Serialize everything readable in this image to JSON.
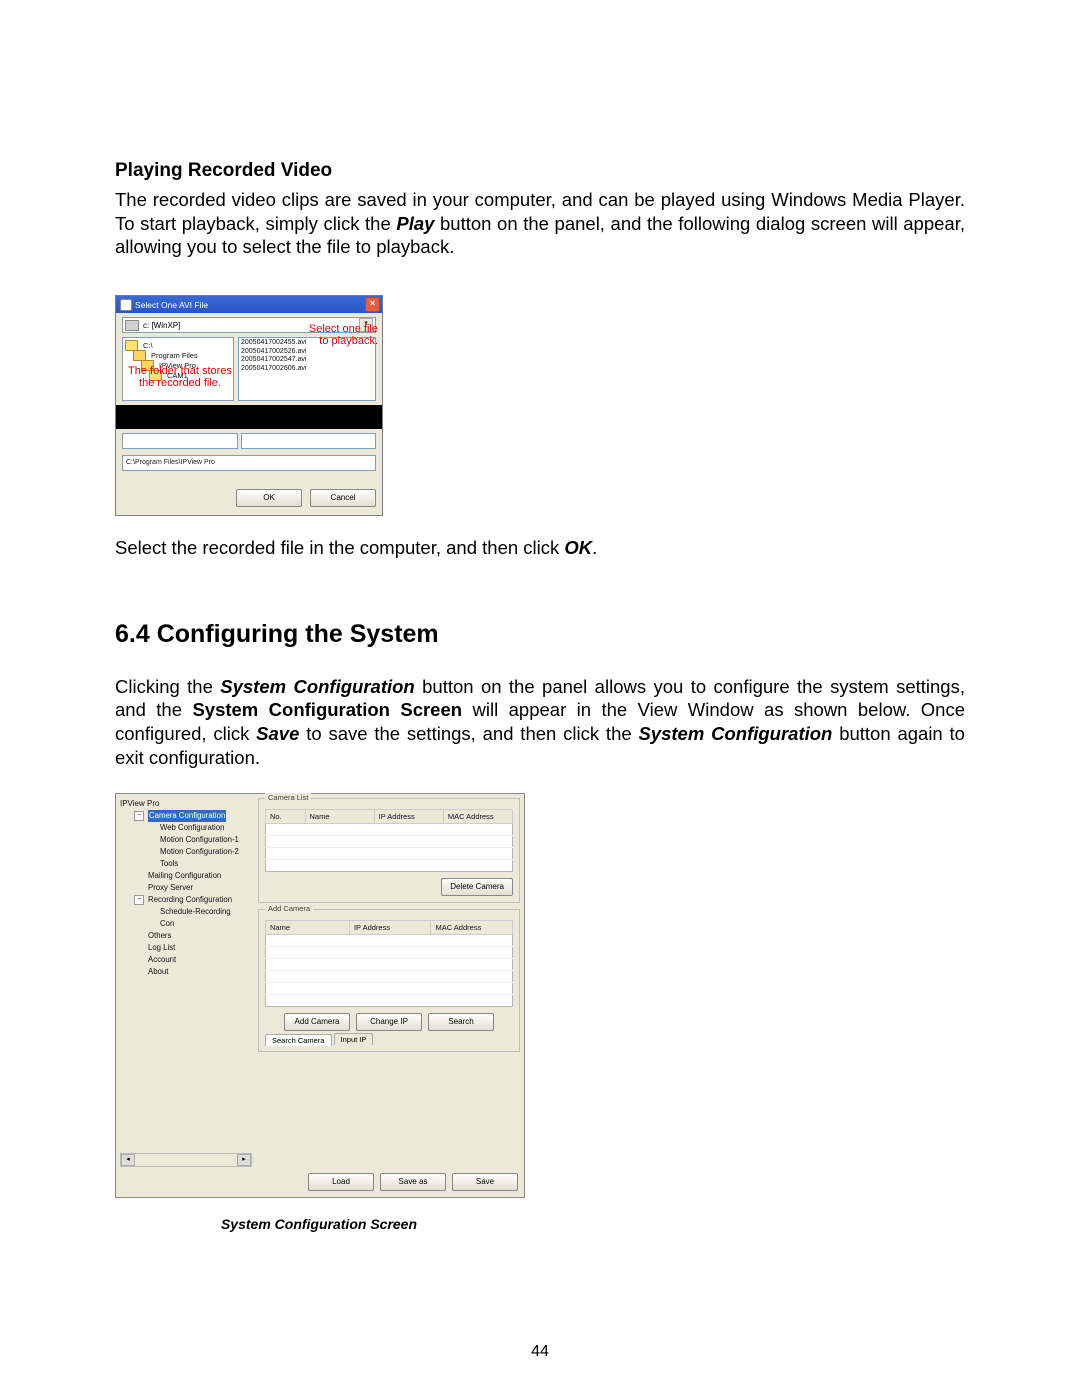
{
  "headings": {
    "h1": "Playing Recorded Video",
    "section64": "6.4 Configuring the System"
  },
  "paragraphs": {
    "p1_a": "The recorded video clips are saved in your computer, and can be played using Windows Media Player. To start playback, simply click the ",
    "p1_play": "Play",
    "p1_b": " button on the panel, and the following dialog screen will appear, allowing you to select the file to playback.",
    "p2_a": "Select the recorded file in the computer, and then click ",
    "p2_ok": "OK",
    "p2_b": ".",
    "p3_a": "Clicking the ",
    "p3_sysconf": "System Configuration",
    "p3_b": " button on the panel allows you to configure the system settings, and the ",
    "p3_scs": "System Configuration Screen",
    "p3_c": " will appear in the View Window as shown below. Once configured, click ",
    "p3_save": "Save",
    "p3_d": " to save the settings, and then click the ",
    "p3_sysconf2": "System Configuration",
    "p3_e": " button again to exit configuration."
  },
  "dialog1": {
    "title": "Select One AVI File",
    "drive_label": "c: [WinXP]",
    "tree": {
      "c": "C:\\",
      "progfiles": "Program Files",
      "ipview": "IPView Pro",
      "cam1": "CAM1"
    },
    "avi_files": [
      "20050417002455.avi",
      "20050417002526.avi",
      "20050417002547.avi",
      "20050417002606.avi"
    ],
    "path_value": "C:\\Program Files\\IPView Pro",
    "ok": "OK",
    "cancel": "Cancel",
    "annot_left_l1": "The folder that stores",
    "annot_left_l2": "the recorded file.",
    "annot_right_l1": "Select one file",
    "annot_right_l2": "to playback."
  },
  "cfg": {
    "tree": {
      "root": "IPView Pro",
      "camera_conf": "Camera Configuration",
      "web_conf": "Web Configuration",
      "motion1": "Motion Configuration-1",
      "motion2": "Motion Configuration-2",
      "tools": "Tools",
      "mailing": "Mailing Configuration",
      "proxy": "Proxy Server",
      "recording": "Recording Configuration",
      "schedule": "Schedule-Recording Con",
      "others": "Others",
      "loglist": "Log List",
      "account": "Account",
      "about": "About"
    },
    "group_camera_list": "Camera List",
    "group_add_camera": "Add Camera",
    "cols_no": "No.",
    "cols_name": "Name",
    "cols_ip": "IP Address",
    "cols_mac": "MAC Address",
    "btn_delete_camera": "Delete Camera",
    "btn_add_camera": "Add Camera",
    "btn_change_ip": "Change IP",
    "btn_search": "Search",
    "tab_search_camera": "Search Camera",
    "tab_input_ip": "Input IP",
    "btn_load": "Load",
    "btn_save_as": "Save as",
    "btn_save": "Save"
  },
  "caption": "System Configuration Screen",
  "page_number": "44"
}
